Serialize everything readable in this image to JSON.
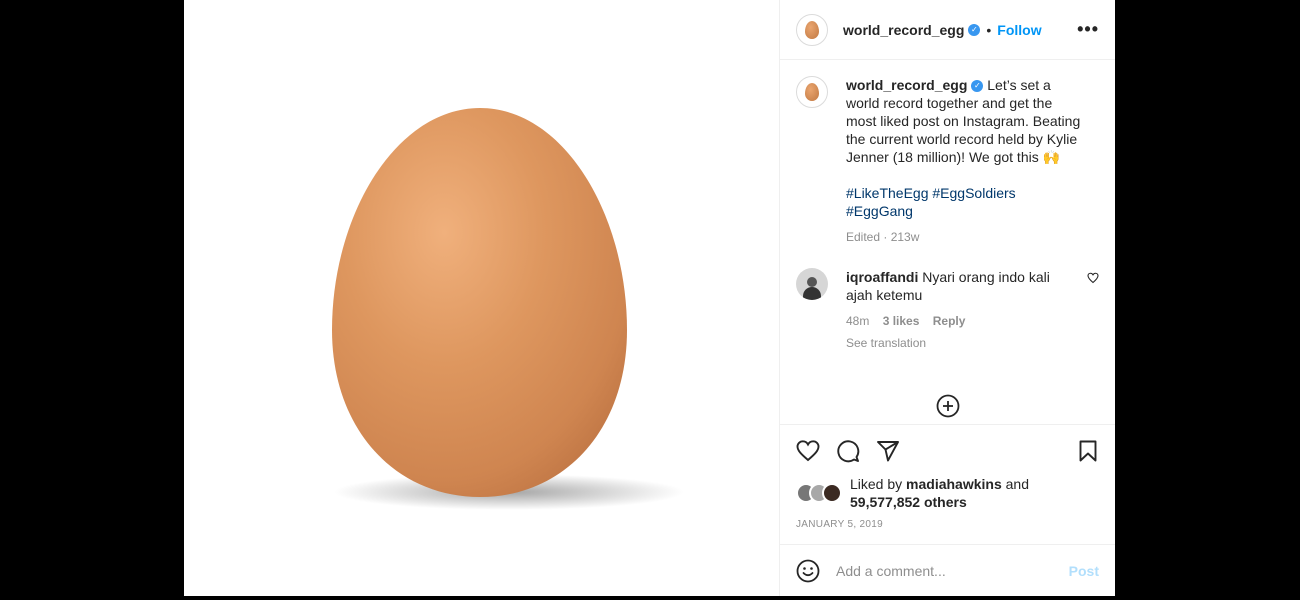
{
  "post": {
    "username": "world_record_egg",
    "follow_label": "Follow",
    "separator": "•",
    "more_label": "•••"
  },
  "caption": {
    "username": "world_record_egg",
    "text": "Let’s set a world record together and get the most liked post on Instagram. Beating the current world record held by Kylie Jenner (18 million)! We got this 🙌",
    "hashtags": "#LikeTheEgg #EggSoldiers #EggGang",
    "edited": "Edited",
    "time": "213w"
  },
  "comment": {
    "username": "iqroaffandi",
    "text": "Nyari orang indo kali ajah ketemu",
    "time": "48m",
    "likes": "3 likes",
    "reply_label": "Reply",
    "see_translation": "See translation"
  },
  "likes": {
    "prefix": "Liked by",
    "user": "madiahawkins",
    "and": "and",
    "count": "59,577,852 others"
  },
  "date": "January 5, 2019",
  "add_comment": {
    "placeholder": "Add a comment...",
    "post_label": "Post"
  },
  "colors": {
    "link_blue": "#0095f6",
    "hashtag_blue": "#00376b",
    "egg": "#d9925a",
    "post_disabled": "#b2dffc"
  },
  "icons": {
    "header_avatar": "egg-avatar-icon",
    "verified": "verified-badge-icon",
    "comment_heart": "heart-outline-icon",
    "load_more": "plus-circle-icon",
    "like": "heart-outline-icon",
    "comment": "comment-bubble-icon",
    "share": "paper-plane-icon",
    "save": "bookmark-icon",
    "emoji": "smiley-icon"
  }
}
